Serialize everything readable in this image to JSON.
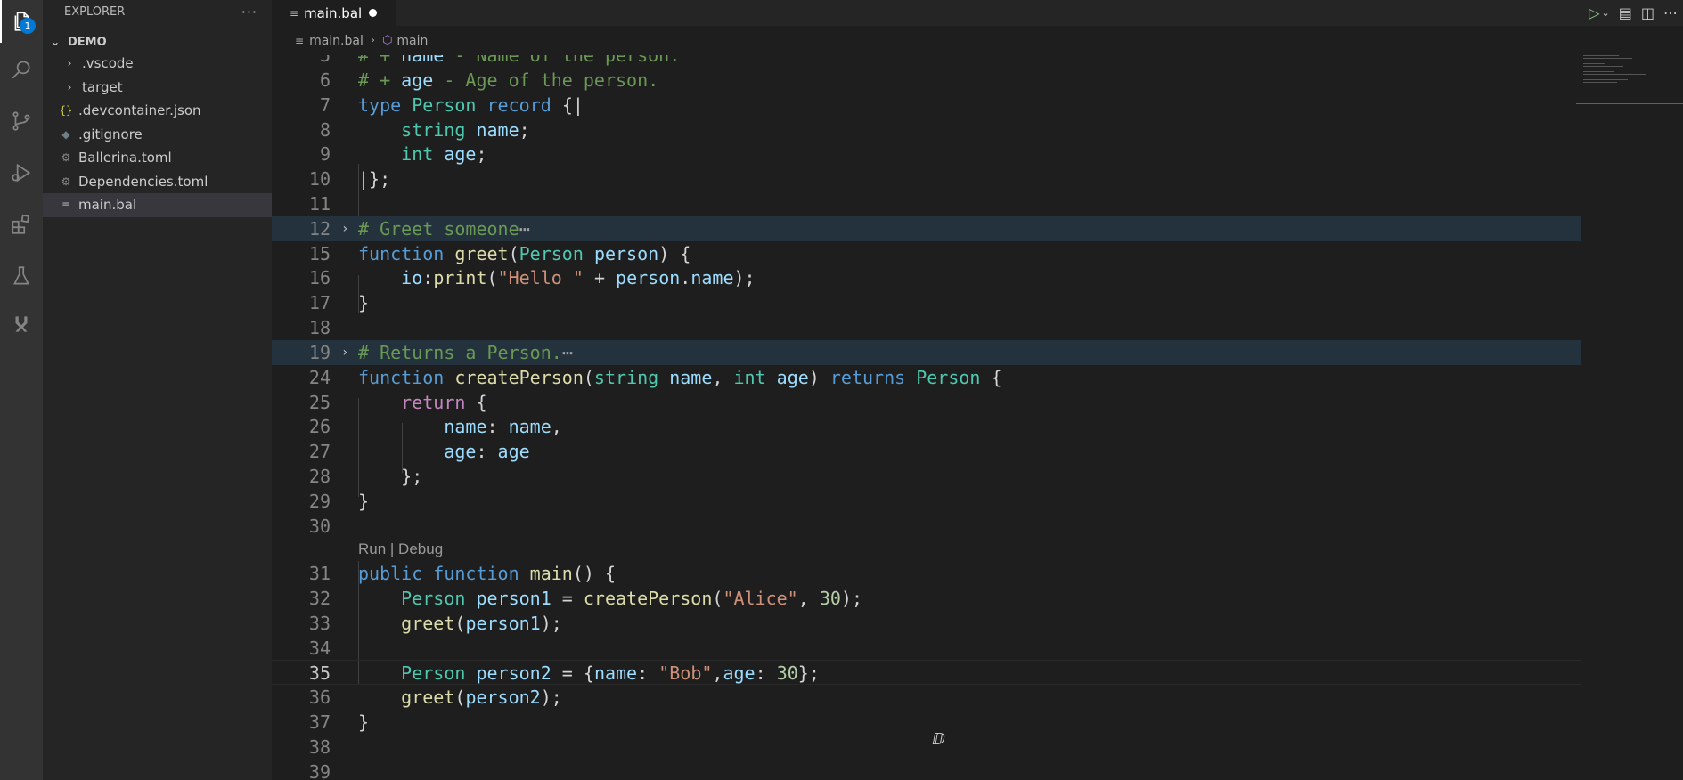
{
  "activity_bar": {
    "explorer_badge": "1",
    "icons": [
      "files-icon",
      "search-icon",
      "source-control-icon",
      "run-debug-icon",
      "extensions-icon",
      "testing-icon",
      "ballerina-icon"
    ]
  },
  "sidebar": {
    "title": "EXPLORER",
    "more": "···",
    "section": "DEMO",
    "items": [
      {
        "label": ".vscode",
        "kind": "folder"
      },
      {
        "label": "target",
        "kind": "folder"
      },
      {
        "label": ".devcontainer.json",
        "kind": "json"
      },
      {
        "label": ".gitignore",
        "kind": "git"
      },
      {
        "label": "Ballerina.toml",
        "kind": "toml"
      },
      {
        "label": "Dependencies.toml",
        "kind": "toml"
      },
      {
        "label": "main.bal",
        "kind": "bal"
      }
    ]
  },
  "tab": {
    "label": "main.bal",
    "dirty": true
  },
  "breadcrumbs": {
    "file": "main.bal",
    "symbol": "main"
  },
  "codelens": "Run | Debug",
  "current_line": "35",
  "colors": {
    "background": "#1e1e1e",
    "sidebar": "#252526",
    "activity_bar": "#333333",
    "accent": "#0078d4"
  }
}
